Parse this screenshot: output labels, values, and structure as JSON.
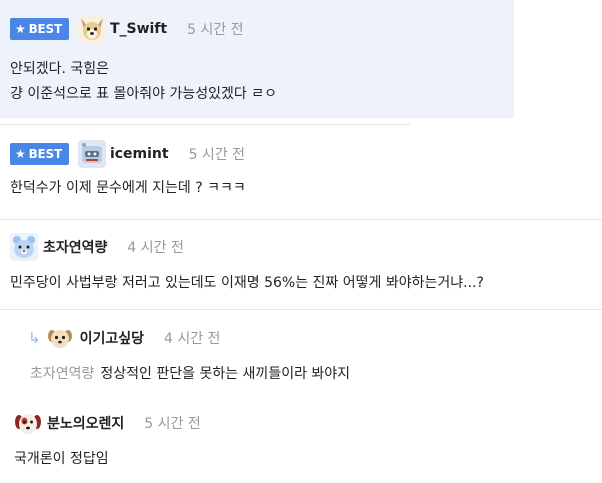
{
  "comments": [
    {
      "best_badge": "BEST",
      "nickname": "T_Swift",
      "time": "5 시간 전",
      "lines": [
        "안되겠다. 국힘은",
        "걍 이준석으로 표 몰아줘야 가능성있겠다 ㄹㅇ"
      ],
      "avatar_icon": "dog-avatar-icon"
    },
    {
      "best_badge": "BEST",
      "nickname": "icemint",
      "time": "5 시간 전",
      "lines": [
        "한덕수가 이제 문수에게 지는데 ? ㅋㅋㅋ"
      ],
      "avatar_icon": "mint-robot-avatar-icon"
    },
    {
      "nickname": "초자연역량",
      "time": "4 시간 전",
      "lines": [
        "민주당이 사법부랑 저러고 있는데도 이재명 56%는 진짜 어떻게 봐야하는거냐...?"
      ],
      "avatar_icon": "blue-bear-avatar-icon"
    },
    {
      "nickname": "이기고싶당",
      "time": "4 시간 전",
      "mention": "초자연역량",
      "lines": [
        "정상적인 판단을 못하는 새끼들이라 봐야지"
      ],
      "avatar_icon": "puppy-avatar-icon"
    },
    {
      "nickname": "분노의오렌지",
      "time": "5 시간 전",
      "lines": [
        "국개론이 정답임"
      ],
      "avatar_icon": "red-puppy-avatar-icon"
    }
  ],
  "colors": {
    "best_badge": "#4a86e8",
    "best_background": "#eef2fb",
    "time_text": "#999999",
    "mention_text": "#9a9a9a"
  }
}
